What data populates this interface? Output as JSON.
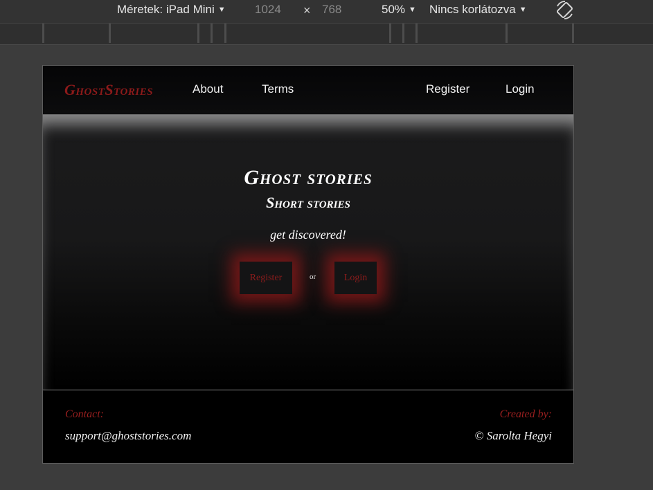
{
  "devtools": {
    "dimensions_label": "Méretek: iPad Mini",
    "width_value": "1024",
    "times": "×",
    "height_value": "768",
    "zoom": "50%",
    "throttling": "Nincs korlátozva",
    "rotate_icon": "rotate-icon"
  },
  "site": {
    "brand": "GhostStories",
    "nav": {
      "about": "About",
      "terms": "Terms",
      "register": "Register",
      "login": "Login"
    },
    "hero": {
      "title": "Ghost stories",
      "subtitle": "Short stories",
      "tagline": "get discovered!",
      "register_button": "Register",
      "or": "or",
      "login_button": "Login"
    },
    "footer": {
      "contact_label": "Contact:",
      "contact_email": "support@ghoststories.com",
      "created_label": "Created by:",
      "created_value": "© Sarolta Hegyi"
    }
  },
  "colors": {
    "accent_red": "#8c1a1a",
    "devtools_bg": "#333333",
    "page_bg": "#000000"
  }
}
